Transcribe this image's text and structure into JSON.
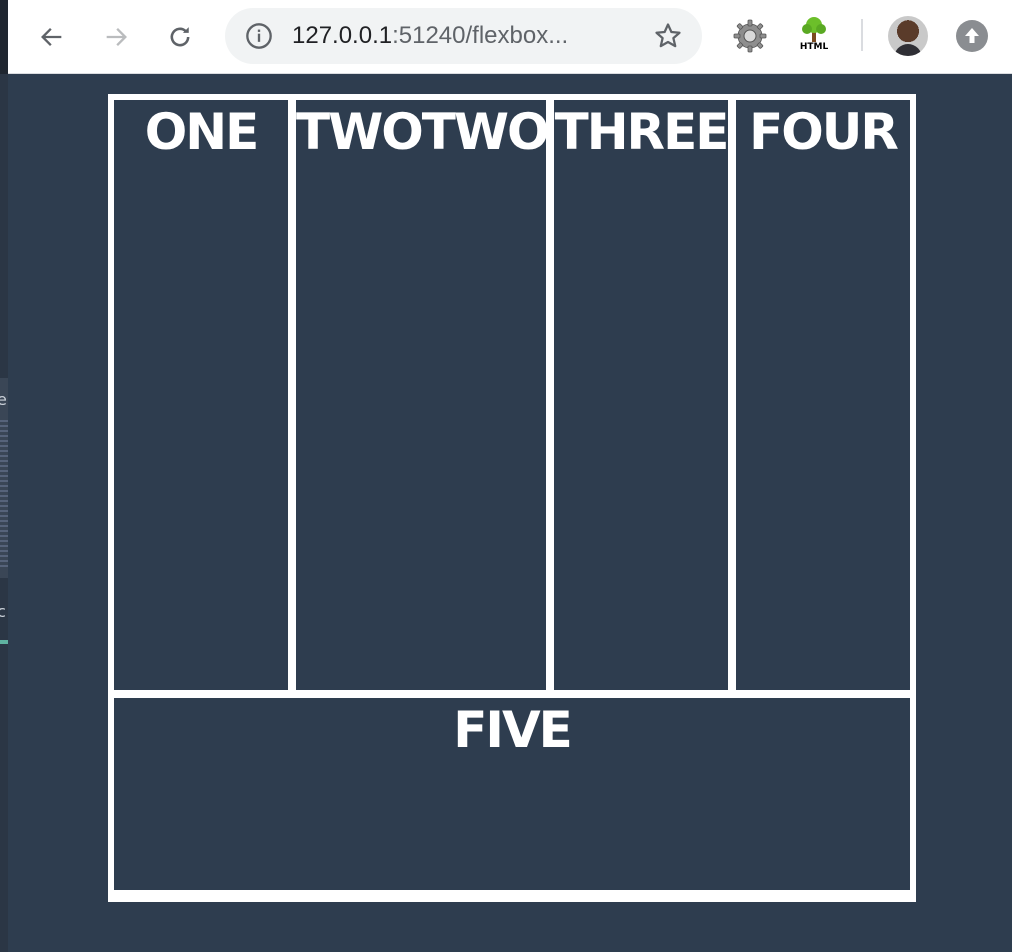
{
  "browser": {
    "url_host": "127.0.0.1",
    "url_rest": ":51240/flexbox...",
    "extension_tree_label": "HTML"
  },
  "page": {
    "boxes": [
      {
        "label": "ONE"
      },
      {
        "label": "TWOTWO"
      },
      {
        "label": "THREE"
      },
      {
        "label": "FOUR"
      },
      {
        "label": "FIVE"
      }
    ]
  },
  "left_strip": {
    "glyph_top": "e",
    "glyph_bottom": "c"
  },
  "colors": {
    "page_background": "#2e3d4f",
    "container_border": "#ffffff",
    "box_text": "#ffffff"
  }
}
